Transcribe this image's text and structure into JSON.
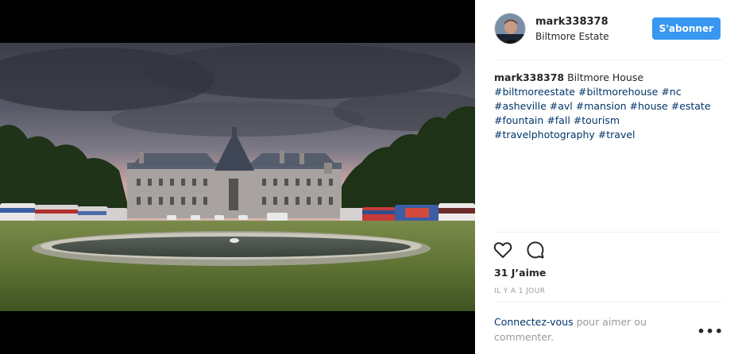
{
  "post": {
    "username": "mark338378",
    "location": "Biltmore Estate",
    "follow_label": "S'abonner",
    "caption_user": "mark338378",
    "caption_text": "Biltmore House",
    "hashtags": [
      "#biltmoreestate",
      "#biltmorehouse",
      "#nc",
      "#asheville",
      "#avl",
      "#mansion",
      "#house",
      "#estate",
      "#fountain",
      "#fall",
      "#tourism",
      "#travelphotography",
      "#travel"
    ],
    "likes": "31 J’aime",
    "time": "IL Y A 1 JOUR",
    "login_link": "Connectez-vous",
    "login_text": " pour aimer ou commenter.",
    "more_label": "•••"
  },
  "icons": {
    "like": "heart-icon",
    "comment": "comment-icon",
    "more": "more-options-icon"
  },
  "colors": {
    "follow_button": "#3897f0",
    "hashtag": "#003569",
    "muted": "#999999"
  }
}
